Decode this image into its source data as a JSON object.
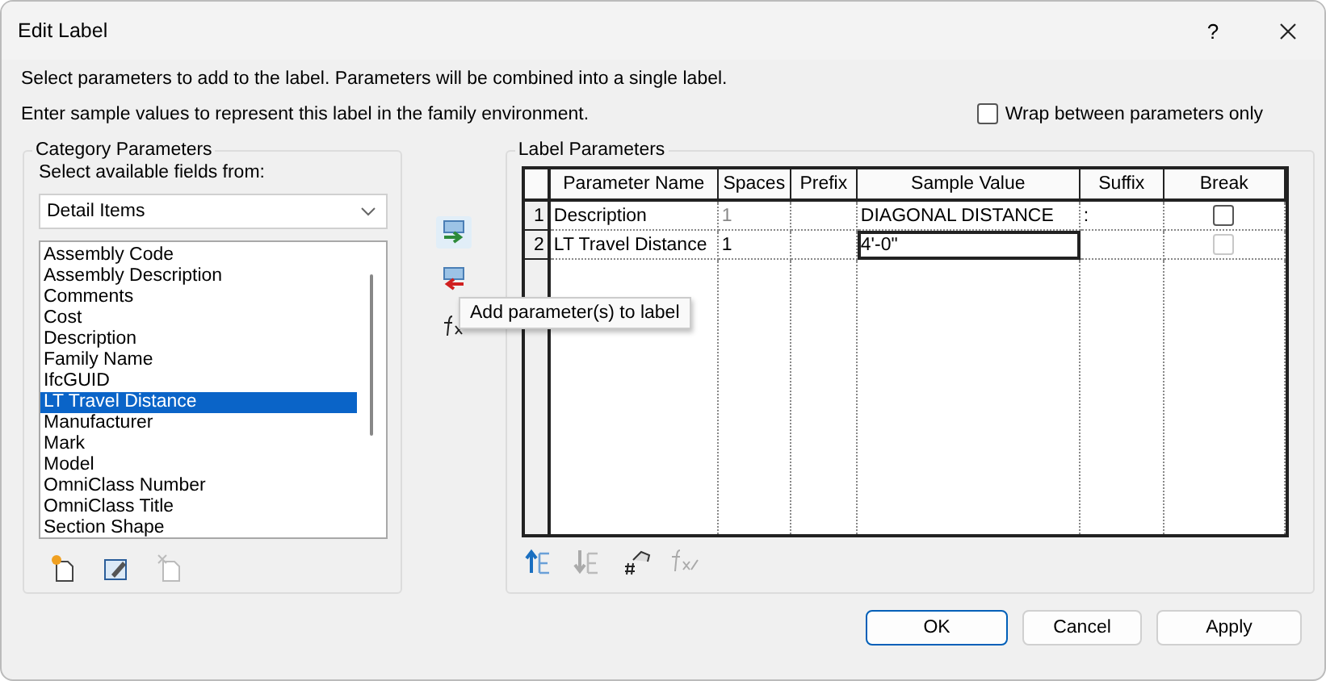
{
  "window": {
    "title": "Edit Label",
    "help": "?"
  },
  "instructions": [
    "Select parameters to add to the label.  Parameters will be combined into a single label.",
    "Enter sample values to represent this label in the family environment."
  ],
  "wrap_option": {
    "label": "Wrap between parameters only",
    "checked": false
  },
  "category_parameters": {
    "title": "Category Parameters",
    "prompt": "Select available fields from:",
    "category": "Detail Items",
    "fields": [
      {
        "label": "Assembly Code",
        "selected": false
      },
      {
        "label": "Assembly Description",
        "selected": false
      },
      {
        "label": "Comments",
        "selected": false
      },
      {
        "label": "Cost",
        "selected": false
      },
      {
        "label": "Description",
        "selected": false
      },
      {
        "label": "Family Name",
        "selected": false
      },
      {
        "label": "IfcGUID",
        "selected": false
      },
      {
        "label": "LT Travel Distance",
        "selected": true
      },
      {
        "label": "Manufacturer",
        "selected": false
      },
      {
        "label": "Mark",
        "selected": false
      },
      {
        "label": "Model",
        "selected": false
      },
      {
        "label": "OmniClass Number",
        "selected": false
      },
      {
        "label": "OmniClass Title",
        "selected": false
      },
      {
        "label": "Section Shape",
        "selected": false
      }
    ]
  },
  "tooltip": "Add parameter(s) to label",
  "label_parameters": {
    "title": "Label Parameters",
    "columns": [
      "Parameter Name",
      "Spaces",
      "Prefix",
      "Sample Value",
      "Suffix",
      "Break"
    ],
    "rows": [
      {
        "number": "1",
        "name": "Description",
        "spaces": "1",
        "spaces_disabled": true,
        "prefix": "",
        "sample": "DIAGONAL DISTANCE",
        "editing": false,
        "suffix": ":",
        "break": false,
        "break_disabled": false
      },
      {
        "number": "2",
        "name": "LT Travel Distance",
        "spaces": "1",
        "spaces_disabled": false,
        "prefix": "",
        "sample": "4'-0\"",
        "editing": true,
        "suffix": "",
        "break": false,
        "break_disabled": true
      }
    ]
  },
  "buttons": [
    {
      "label": "OK",
      "default": true
    },
    {
      "label": "Cancel",
      "default": false
    },
    {
      "label": "Apply",
      "default": false
    }
  ]
}
